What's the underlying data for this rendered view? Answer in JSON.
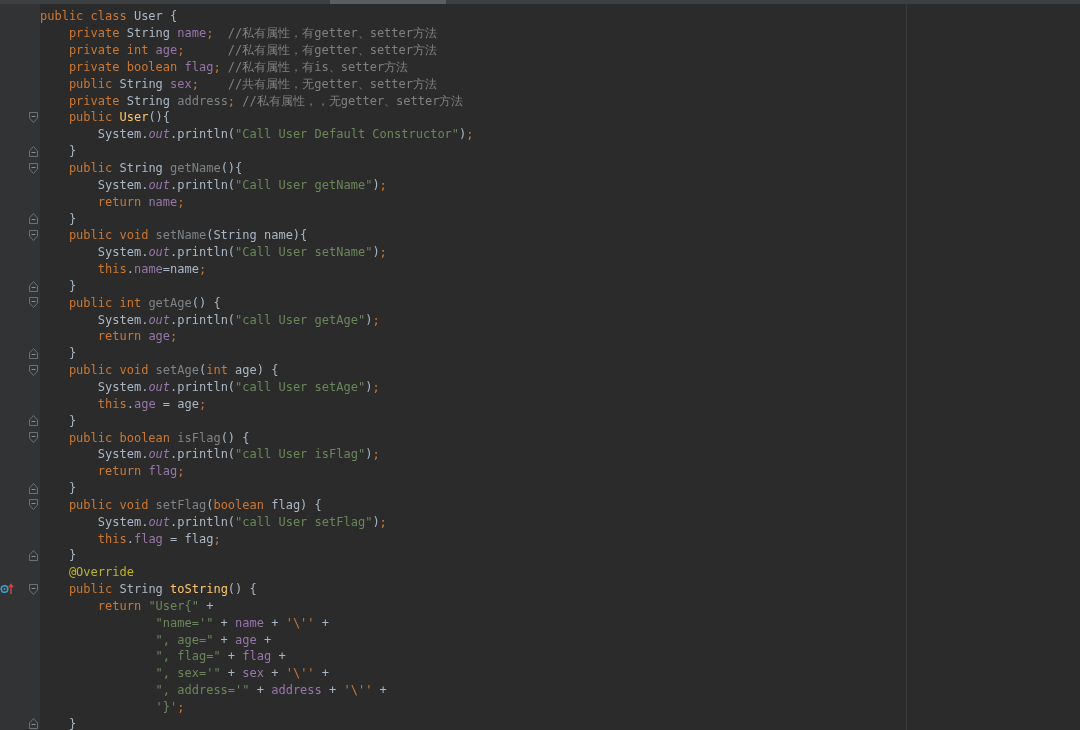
{
  "editor": {
    "lines": [
      {
        "fold_start": false,
        "fold_end": false,
        "override": false,
        "tokens": [
          {
            "kind": "keyword",
            "text": "public class "
          },
          {
            "kind": "plain",
            "text": "User {"
          }
        ]
      },
      {
        "fold_start": false,
        "fold_end": false,
        "override": false,
        "tokens": [
          {
            "kind": "keyword",
            "text": "    private "
          },
          {
            "kind": "plain",
            "text": "String "
          },
          {
            "kind": "field",
            "text": "name"
          },
          {
            "kind": "keyword",
            "text": ";"
          },
          {
            "kind": "comment",
            "text": "  //私有属性，有getter、setter方法"
          }
        ]
      },
      {
        "fold_start": false,
        "fold_end": false,
        "override": false,
        "tokens": [
          {
            "kind": "keyword",
            "text": "    private int "
          },
          {
            "kind": "field",
            "text": "age"
          },
          {
            "kind": "keyword",
            "text": ";"
          },
          {
            "kind": "comment",
            "text": "      //私有属性，有getter、setter方法"
          }
        ]
      },
      {
        "fold_start": false,
        "fold_end": false,
        "override": false,
        "tokens": [
          {
            "kind": "keyword",
            "text": "    private boolean "
          },
          {
            "kind": "field",
            "text": "flag"
          },
          {
            "kind": "keyword",
            "text": ";"
          },
          {
            "kind": "comment",
            "text": " //私有属性，有is、setter方法"
          }
        ]
      },
      {
        "fold_start": false,
        "fold_end": false,
        "override": false,
        "tokens": [
          {
            "kind": "keyword",
            "text": "    public "
          },
          {
            "kind": "plain",
            "text": "String "
          },
          {
            "kind": "field",
            "text": "sex"
          },
          {
            "kind": "keyword",
            "text": ";"
          },
          {
            "kind": "comment",
            "text": "    //共有属性，无getter、setter方法"
          }
        ]
      },
      {
        "fold_start": false,
        "fold_end": false,
        "override": false,
        "tokens": [
          {
            "kind": "keyword",
            "text": "    private "
          },
          {
            "kind": "plain",
            "text": "String "
          },
          {
            "kind": "unused",
            "text": "address"
          },
          {
            "kind": "keyword",
            "text": ";"
          },
          {
            "kind": "comment",
            "text": " //私有属性，，无getter、setter方法"
          }
        ]
      },
      {
        "fold_start": true,
        "fold_end": false,
        "override": false,
        "tokens": [
          {
            "kind": "keyword",
            "text": "    public "
          },
          {
            "kind": "method",
            "text": "User"
          },
          {
            "kind": "plain",
            "text": "(){"
          }
        ]
      },
      {
        "fold_start": false,
        "fold_end": false,
        "override": false,
        "tokens": [
          {
            "kind": "plain",
            "text": "        System."
          },
          {
            "kind": "static",
            "text": "out"
          },
          {
            "kind": "plain",
            "text": ".println("
          },
          {
            "kind": "string",
            "text": "\"Call User Default Constructor\""
          },
          {
            "kind": "plain",
            "text": ")"
          },
          {
            "kind": "keyword",
            "text": ";"
          }
        ]
      },
      {
        "fold_start": false,
        "fold_end": true,
        "override": false,
        "tokens": [
          {
            "kind": "plain",
            "text": "    }"
          }
        ]
      },
      {
        "fold_start": true,
        "fold_end": false,
        "override": false,
        "tokens": [
          {
            "kind": "keyword",
            "text": "    public "
          },
          {
            "kind": "plain",
            "text": "String "
          },
          {
            "kind": "unused",
            "text": "getName"
          },
          {
            "kind": "plain",
            "text": "(){"
          }
        ]
      },
      {
        "fold_start": false,
        "fold_end": false,
        "override": false,
        "tokens": [
          {
            "kind": "plain",
            "text": "        System."
          },
          {
            "kind": "static",
            "text": "out"
          },
          {
            "kind": "plain",
            "text": ".println("
          },
          {
            "kind": "string",
            "text": "\"Call User getName\""
          },
          {
            "kind": "plain",
            "text": ")"
          },
          {
            "kind": "keyword",
            "text": ";"
          }
        ]
      },
      {
        "fold_start": false,
        "fold_end": false,
        "override": false,
        "tokens": [
          {
            "kind": "keyword",
            "text": "        return "
          },
          {
            "kind": "field",
            "text": "name"
          },
          {
            "kind": "keyword",
            "text": ";"
          }
        ]
      },
      {
        "fold_start": false,
        "fold_end": true,
        "override": false,
        "tokens": [
          {
            "kind": "plain",
            "text": "    }"
          }
        ]
      },
      {
        "fold_start": true,
        "fold_end": false,
        "override": false,
        "tokens": [
          {
            "kind": "keyword",
            "text": "    public void "
          },
          {
            "kind": "unused",
            "text": "setName"
          },
          {
            "kind": "plain",
            "text": "(String name){"
          }
        ]
      },
      {
        "fold_start": false,
        "fold_end": false,
        "override": false,
        "tokens": [
          {
            "kind": "plain",
            "text": "        System."
          },
          {
            "kind": "static",
            "text": "out"
          },
          {
            "kind": "plain",
            "text": ".println("
          },
          {
            "kind": "string",
            "text": "\"Call User setName\""
          },
          {
            "kind": "plain",
            "text": ")"
          },
          {
            "kind": "keyword",
            "text": ";"
          }
        ]
      },
      {
        "fold_start": false,
        "fold_end": false,
        "override": false,
        "tokens": [
          {
            "kind": "keyword",
            "text": "        this"
          },
          {
            "kind": "plain",
            "text": "."
          },
          {
            "kind": "field",
            "text": "name"
          },
          {
            "kind": "plain",
            "text": "=name"
          },
          {
            "kind": "keyword",
            "text": ";"
          }
        ]
      },
      {
        "fold_start": false,
        "fold_end": true,
        "override": false,
        "tokens": [
          {
            "kind": "plain",
            "text": "    }"
          }
        ]
      },
      {
        "fold_start": true,
        "fold_end": false,
        "override": false,
        "tokens": [
          {
            "kind": "keyword",
            "text": "    public int "
          },
          {
            "kind": "unused",
            "text": "getAge"
          },
          {
            "kind": "plain",
            "text": "() {"
          }
        ]
      },
      {
        "fold_start": false,
        "fold_end": false,
        "override": false,
        "tokens": [
          {
            "kind": "plain",
            "text": "        System."
          },
          {
            "kind": "static",
            "text": "out"
          },
          {
            "kind": "plain",
            "text": ".println("
          },
          {
            "kind": "string",
            "text": "\"call User getAge\""
          },
          {
            "kind": "plain",
            "text": ")"
          },
          {
            "kind": "keyword",
            "text": ";"
          }
        ]
      },
      {
        "fold_start": false,
        "fold_end": false,
        "override": false,
        "tokens": [
          {
            "kind": "keyword",
            "text": "        return "
          },
          {
            "kind": "field",
            "text": "age"
          },
          {
            "kind": "keyword",
            "text": ";"
          }
        ]
      },
      {
        "fold_start": false,
        "fold_end": true,
        "override": false,
        "tokens": [
          {
            "kind": "plain",
            "text": "    }"
          }
        ]
      },
      {
        "fold_start": true,
        "fold_end": false,
        "override": false,
        "tokens": [
          {
            "kind": "keyword",
            "text": "    public void "
          },
          {
            "kind": "unused",
            "text": "setAge"
          },
          {
            "kind": "plain",
            "text": "("
          },
          {
            "kind": "keyword",
            "text": "int "
          },
          {
            "kind": "plain",
            "text": "age) {"
          }
        ]
      },
      {
        "fold_start": false,
        "fold_end": false,
        "override": false,
        "tokens": [
          {
            "kind": "plain",
            "text": "        System."
          },
          {
            "kind": "static",
            "text": "out"
          },
          {
            "kind": "plain",
            "text": ".println("
          },
          {
            "kind": "string",
            "text": "\"call User setAge\""
          },
          {
            "kind": "plain",
            "text": ")"
          },
          {
            "kind": "keyword",
            "text": ";"
          }
        ]
      },
      {
        "fold_start": false,
        "fold_end": false,
        "override": false,
        "tokens": [
          {
            "kind": "keyword",
            "text": "        this"
          },
          {
            "kind": "plain",
            "text": "."
          },
          {
            "kind": "field",
            "text": "age"
          },
          {
            "kind": "plain",
            "text": " = age"
          },
          {
            "kind": "keyword",
            "text": ";"
          }
        ]
      },
      {
        "fold_start": false,
        "fold_end": true,
        "override": false,
        "tokens": [
          {
            "kind": "plain",
            "text": "    }"
          }
        ]
      },
      {
        "fold_start": true,
        "fold_end": false,
        "override": false,
        "tokens": [
          {
            "kind": "keyword",
            "text": "    public boolean "
          },
          {
            "kind": "unused",
            "text": "isFlag"
          },
          {
            "kind": "plain",
            "text": "() {"
          }
        ]
      },
      {
        "fold_start": false,
        "fold_end": false,
        "override": false,
        "tokens": [
          {
            "kind": "plain",
            "text": "        System."
          },
          {
            "kind": "static",
            "text": "out"
          },
          {
            "kind": "plain",
            "text": ".println("
          },
          {
            "kind": "string",
            "text": "\"call User isFlag\""
          },
          {
            "kind": "plain",
            "text": ")"
          },
          {
            "kind": "keyword",
            "text": ";"
          }
        ]
      },
      {
        "fold_start": false,
        "fold_end": false,
        "override": false,
        "tokens": [
          {
            "kind": "keyword",
            "text": "        return "
          },
          {
            "kind": "field",
            "text": "flag"
          },
          {
            "kind": "keyword",
            "text": ";"
          }
        ]
      },
      {
        "fold_start": false,
        "fold_end": true,
        "override": false,
        "tokens": [
          {
            "kind": "plain",
            "text": "    }"
          }
        ]
      },
      {
        "fold_start": true,
        "fold_end": false,
        "override": false,
        "tokens": [
          {
            "kind": "keyword",
            "text": "    public void "
          },
          {
            "kind": "unused",
            "text": "setFlag"
          },
          {
            "kind": "plain",
            "text": "("
          },
          {
            "kind": "keyword",
            "text": "boolean "
          },
          {
            "kind": "plain",
            "text": "flag) {"
          }
        ]
      },
      {
        "fold_start": false,
        "fold_end": false,
        "override": false,
        "tokens": [
          {
            "kind": "plain",
            "text": "        System."
          },
          {
            "kind": "static",
            "text": "out"
          },
          {
            "kind": "plain",
            "text": ".println("
          },
          {
            "kind": "string",
            "text": "\"call User setFlag\""
          },
          {
            "kind": "plain",
            "text": ")"
          },
          {
            "kind": "keyword",
            "text": ";"
          }
        ]
      },
      {
        "fold_start": false,
        "fold_end": false,
        "override": false,
        "tokens": [
          {
            "kind": "keyword",
            "text": "        this"
          },
          {
            "kind": "plain",
            "text": "."
          },
          {
            "kind": "field",
            "text": "flag"
          },
          {
            "kind": "plain",
            "text": " = flag"
          },
          {
            "kind": "keyword",
            "text": ";"
          }
        ]
      },
      {
        "fold_start": false,
        "fold_end": true,
        "override": false,
        "tokens": [
          {
            "kind": "plain",
            "text": "    }"
          }
        ]
      },
      {
        "fold_start": false,
        "fold_end": false,
        "override": false,
        "tokens": [
          {
            "kind": "annotation",
            "text": "    @Override"
          }
        ]
      },
      {
        "fold_start": true,
        "fold_end": false,
        "override": true,
        "tokens": [
          {
            "kind": "keyword",
            "text": "    public "
          },
          {
            "kind": "plain",
            "text": "String "
          },
          {
            "kind": "method",
            "text": "toString"
          },
          {
            "kind": "plain",
            "text": "() {"
          }
        ]
      },
      {
        "fold_start": false,
        "fold_end": false,
        "override": false,
        "tokens": [
          {
            "kind": "keyword",
            "text": "        return "
          },
          {
            "kind": "string",
            "text": "\"User{\""
          },
          {
            "kind": "plain",
            "text": " +"
          }
        ]
      },
      {
        "fold_start": false,
        "fold_end": false,
        "override": false,
        "tokens": [
          {
            "kind": "string",
            "text": "                \"name='\""
          },
          {
            "kind": "plain",
            "text": " + "
          },
          {
            "kind": "field",
            "text": "name"
          },
          {
            "kind": "plain",
            "text": " + "
          },
          {
            "kind": "keyword",
            "text": "'\\''"
          },
          {
            "kind": "plain",
            "text": " +"
          }
        ]
      },
      {
        "fold_start": false,
        "fold_end": false,
        "override": false,
        "tokens": [
          {
            "kind": "string",
            "text": "                \", age=\""
          },
          {
            "kind": "plain",
            "text": " + "
          },
          {
            "kind": "field",
            "text": "age"
          },
          {
            "kind": "plain",
            "text": " +"
          }
        ]
      },
      {
        "fold_start": false,
        "fold_end": false,
        "override": false,
        "tokens": [
          {
            "kind": "string",
            "text": "                \", flag=\""
          },
          {
            "kind": "plain",
            "text": " + "
          },
          {
            "kind": "field",
            "text": "flag"
          },
          {
            "kind": "plain",
            "text": " +"
          }
        ]
      },
      {
        "fold_start": false,
        "fold_end": false,
        "override": false,
        "tokens": [
          {
            "kind": "string",
            "text": "                \", sex='\""
          },
          {
            "kind": "plain",
            "text": " + "
          },
          {
            "kind": "field",
            "text": "sex"
          },
          {
            "kind": "plain",
            "text": " + "
          },
          {
            "kind": "keyword",
            "text": "'\\''"
          },
          {
            "kind": "plain",
            "text": " +"
          }
        ]
      },
      {
        "fold_start": false,
        "fold_end": false,
        "override": false,
        "tokens": [
          {
            "kind": "string",
            "text": "                \", address='\""
          },
          {
            "kind": "plain",
            "text": " + "
          },
          {
            "kind": "field",
            "text": "address"
          },
          {
            "kind": "plain",
            "text": " + "
          },
          {
            "kind": "keyword",
            "text": "'\\''"
          },
          {
            "kind": "plain",
            "text": " +"
          }
        ]
      },
      {
        "fold_start": false,
        "fold_end": false,
        "override": false,
        "tokens": [
          {
            "kind": "string",
            "text": "                '}'"
          },
          {
            "kind": "keyword",
            "text": ";"
          }
        ]
      },
      {
        "fold_start": false,
        "fold_end": true,
        "override": false,
        "tokens": [
          {
            "kind": "plain",
            "text": "    }"
          }
        ]
      }
    ]
  }
}
